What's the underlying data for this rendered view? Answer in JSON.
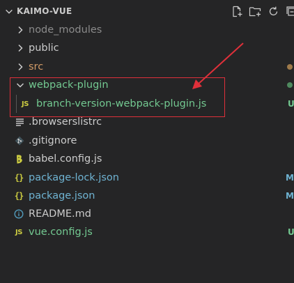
{
  "explorer": {
    "root_title": "KAIMO-VUE",
    "actions": [
      {
        "name": "new-file-icon"
      },
      {
        "name": "new-folder-icon"
      },
      {
        "name": "refresh-icon"
      },
      {
        "name": "collapse-all-icon"
      }
    ]
  },
  "tree": [
    {
      "label": "node_modules",
      "kind": "folder",
      "expanded": false,
      "color": "#8b8b8b",
      "decoration": "",
      "deco_color": ""
    },
    {
      "label": "public",
      "kind": "folder",
      "expanded": false,
      "color": "#cccccc",
      "decoration": "",
      "deco_color": ""
    },
    {
      "label": "src",
      "kind": "folder",
      "expanded": false,
      "color": "#d19a66",
      "decoration": "dot",
      "deco_color": "#9e7a4a"
    },
    {
      "label": "webpack-plugin",
      "kind": "folder",
      "expanded": true,
      "color": "#73c991",
      "decoration": "dot",
      "deco_color": "#4f8a5f"
    },
    {
      "label": "branch-version-webpack-plugin.js",
      "kind": "js",
      "color": "#73c991",
      "decoration": "U",
      "deco_color": "#73c991"
    },
    {
      "label": ".browserslistrc",
      "kind": "lines",
      "color": "#cccccc",
      "decoration": "",
      "deco_color": ""
    },
    {
      "label": ".gitignore",
      "kind": "git",
      "color": "#cccccc",
      "decoration": "",
      "deco_color": ""
    },
    {
      "label": "babel.config.js",
      "kind": "js",
      "color": "#cccccc",
      "decoration": "",
      "deco_color": ""
    },
    {
      "label": "package-lock.json",
      "kind": "json",
      "color": "#6fb3d2",
      "decoration": "M",
      "deco_color": "#6fb3d2"
    },
    {
      "label": "package.json",
      "kind": "json",
      "color": "#6fb3d2",
      "decoration": "M",
      "deco_color": "#6fb3d2"
    },
    {
      "label": "README.md",
      "kind": "info",
      "color": "#cccccc",
      "decoration": "",
      "deco_color": ""
    },
    {
      "label": "vue.config.js",
      "kind": "js",
      "color": "#73c991",
      "decoration": "U",
      "deco_color": "#73c991"
    }
  ],
  "annotation": {
    "box_color": "#e0303a",
    "arrow_color": "#e0303a"
  }
}
